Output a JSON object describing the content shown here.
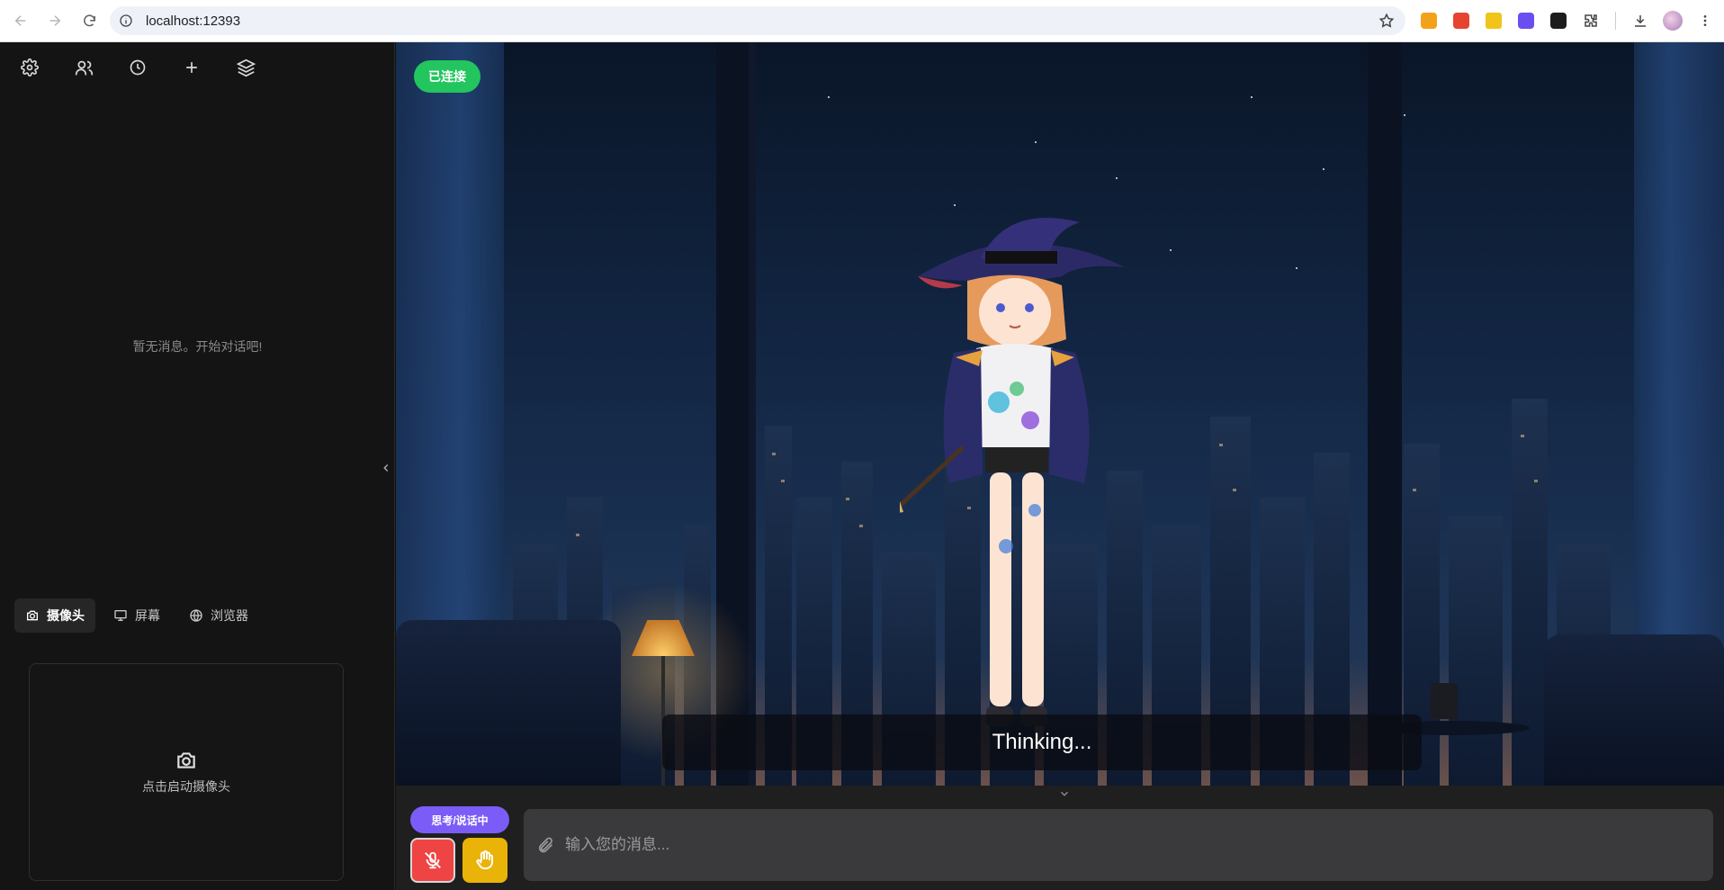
{
  "browser": {
    "url": "localhost:12393"
  },
  "sidebar": {
    "empty_message": "暂无消息。开始对话吧!",
    "source_tabs": [
      {
        "label": "摄像头",
        "icon": "camera-icon",
        "active": true
      },
      {
        "label": "屏幕",
        "icon": "monitor-icon",
        "active": false
      },
      {
        "label": "浏览器",
        "icon": "globe-icon",
        "active": false
      }
    ],
    "camera_prompt": "点击启动摄像头"
  },
  "stage": {
    "status": "已连接",
    "subtitle": "Thinking..."
  },
  "input": {
    "state_label": "思考/说话中",
    "placeholder": "输入您的消息..."
  },
  "colors": {
    "connected": "#22c55e",
    "thinking": "#7c5cf6",
    "mic_off": "#ef4444",
    "interrupt": "#eab308"
  }
}
